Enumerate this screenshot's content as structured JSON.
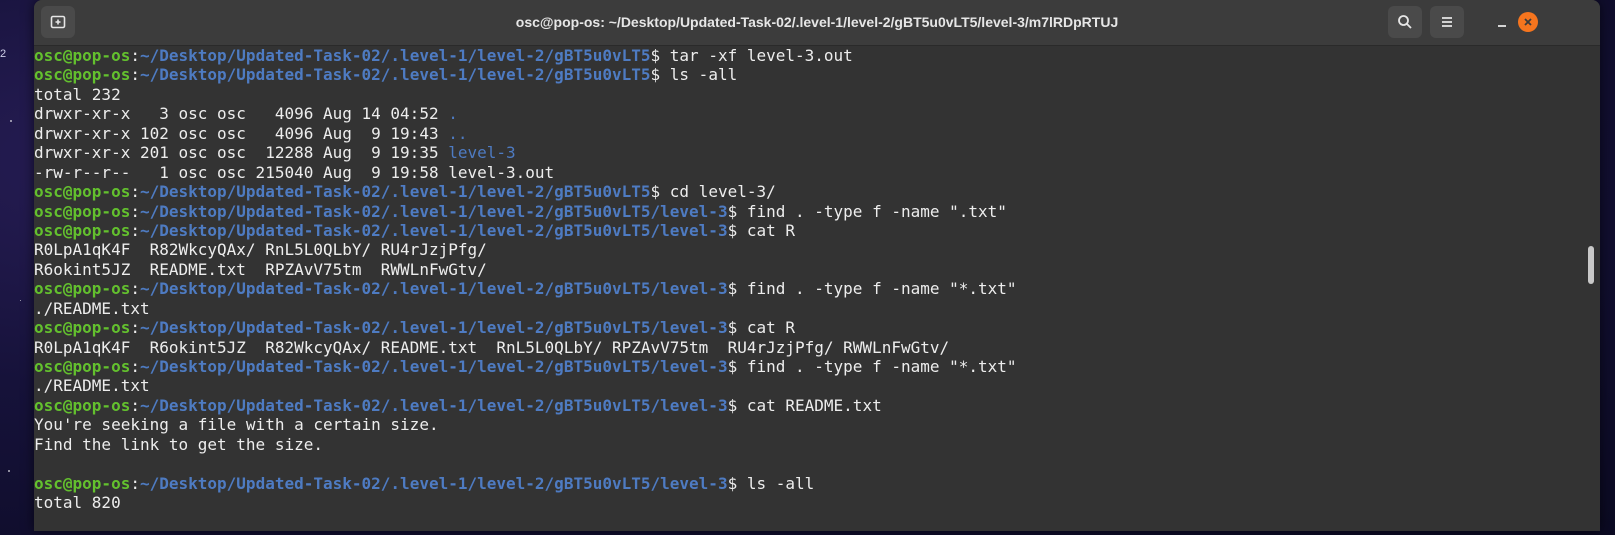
{
  "desktop": {
    "edge_text": "2"
  },
  "window": {
    "title": "osc@pop-os: ~/Desktop/Updated-Task-02/.level-1/level-2/gBT5u0vLT5/level-3/m7lRDpRTUJ"
  },
  "icons": {
    "new_tab": "new-tab-icon",
    "search": "search-icon",
    "menu": "hamburger-menu-icon",
    "minimize": "minimize-icon",
    "close": "close-icon"
  },
  "colors": {
    "user": "#63c02e",
    "path": "#4e7bc2",
    "text": "#ededed",
    "background": "#333333",
    "close": "#f6751e"
  },
  "terminal": {
    "lines": [
      {
        "type": "prompt",
        "user": "osc@pop-os",
        "sep": ":",
        "path": "~/Desktop/Updated-Task-02/.level-1/level-2/gBT5u0vLT5",
        "cmd": "$ tar -xf level-3.out"
      },
      {
        "type": "prompt",
        "user": "osc@pop-os",
        "sep": ":",
        "path": "~/Desktop/Updated-Task-02/.level-1/level-2/gBT5u0vLT5",
        "cmd": "$ ls -all"
      },
      {
        "type": "out",
        "text": "total 232"
      },
      {
        "type": "ls",
        "text": "drwxr-xr-x   3 osc osc   4096 Aug 14 04:52 ",
        "name": "."
      },
      {
        "type": "ls",
        "text": "drwxr-xr-x 102 osc osc   4096 Aug  9 19:43 ",
        "name": ".."
      },
      {
        "type": "ls",
        "text": "drwxr-xr-x 201 osc osc  12288 Aug  9 19:35 ",
        "name": "level-3"
      },
      {
        "type": "out",
        "text": "-rw-r--r--   1 osc osc 215040 Aug  9 19:58 level-3.out"
      },
      {
        "type": "prompt",
        "user": "osc@pop-os",
        "sep": ":",
        "path": "~/Desktop/Updated-Task-02/.level-1/level-2/gBT5u0vLT5",
        "cmd": "$ cd level-3/"
      },
      {
        "type": "prompt",
        "user": "osc@pop-os",
        "sep": ":",
        "path": "~/Desktop/Updated-Task-02/.level-1/level-2/gBT5u0vLT5/level-3",
        "cmd": "$ find . -type f -name \".txt\""
      },
      {
        "type": "prompt",
        "user": "osc@pop-os",
        "sep": ":",
        "path": "~/Desktop/Updated-Task-02/.level-1/level-2/gBT5u0vLT5/level-3",
        "cmd": "$ cat R"
      },
      {
        "type": "out",
        "text": "R0LpA1qK4F  R82WkcyQAx/ RnL5L0QLbY/ RU4rJzjPfg/"
      },
      {
        "type": "out",
        "text": "R6okint5JZ  README.txt  RPZAvV75tm  RWWLnFwGtv/"
      },
      {
        "type": "prompt",
        "user": "osc@pop-os",
        "sep": ":",
        "path": "~/Desktop/Updated-Task-02/.level-1/level-2/gBT5u0vLT5/level-3",
        "cmd": "$ find . -type f -name \"*.txt\""
      },
      {
        "type": "out",
        "text": "./README.txt"
      },
      {
        "type": "prompt",
        "user": "osc@pop-os",
        "sep": ":",
        "path": "~/Desktop/Updated-Task-02/.level-1/level-2/gBT5u0vLT5/level-3",
        "cmd": "$ cat R"
      },
      {
        "type": "out",
        "text": "R0LpA1qK4F  R6okint5JZ  R82WkcyQAx/ README.txt  RnL5L0QLbY/ RPZAvV75tm  RU4rJzjPfg/ RWWLnFwGtv/"
      },
      {
        "type": "prompt",
        "user": "osc@pop-os",
        "sep": ":",
        "path": "~/Desktop/Updated-Task-02/.level-1/level-2/gBT5u0vLT5/level-3",
        "cmd": "$ find . -type f -name \"*.txt\""
      },
      {
        "type": "out",
        "text": "./README.txt"
      },
      {
        "type": "prompt",
        "user": "osc@pop-os",
        "sep": ":",
        "path": "~/Desktop/Updated-Task-02/.level-1/level-2/gBT5u0vLT5/level-3",
        "cmd": "$ cat README.txt"
      },
      {
        "type": "out",
        "text": "You're seeking a file with a certain size."
      },
      {
        "type": "out",
        "text": "Find the link to get the size."
      },
      {
        "type": "out",
        "text": ""
      },
      {
        "type": "prompt",
        "user": "osc@pop-os",
        "sep": ":",
        "path": "~/Desktop/Updated-Task-02/.level-1/level-2/gBT5u0vLT5/level-3",
        "cmd": "$ ls -all"
      },
      {
        "type": "out",
        "text": "total 820"
      }
    ]
  }
}
